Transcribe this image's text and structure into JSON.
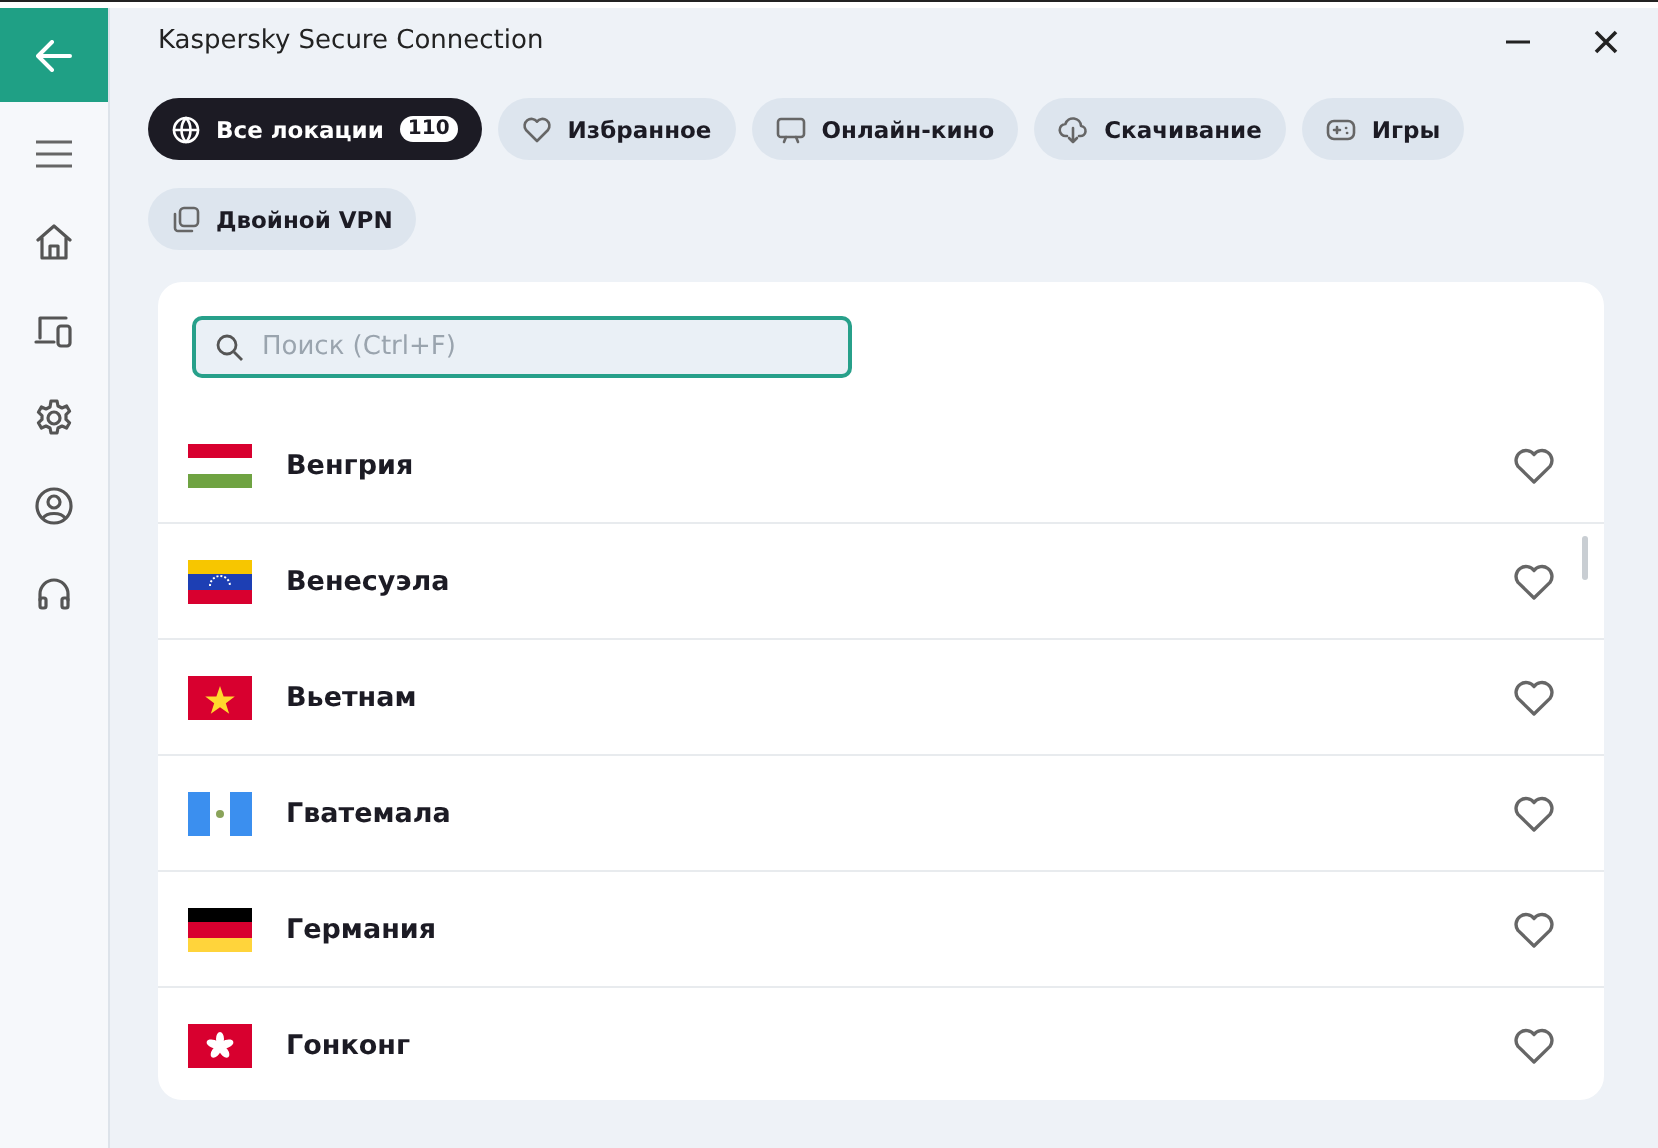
{
  "window": {
    "title": "Kaspersky Secure Connection"
  },
  "sidebar": {
    "items": [
      {
        "kind": "home",
        "selected": false
      },
      {
        "kind": "devices",
        "selected": false
      },
      {
        "kind": "settings",
        "selected": false
      },
      {
        "kind": "account",
        "selected": false
      },
      {
        "kind": "support",
        "selected": false
      }
    ]
  },
  "filters": [
    {
      "label": "Все локации",
      "kind": "globe",
      "count": "110",
      "selected": true
    },
    {
      "label": "Избранное",
      "kind": "heart",
      "selected": false
    },
    {
      "label": "Онлайн-кино",
      "kind": "screen",
      "selected": false
    },
    {
      "label": "Скачивание",
      "kind": "download",
      "selected": false
    },
    {
      "label": "Игры",
      "kind": "gamepad",
      "selected": false
    },
    {
      "label": "Двойной VPN",
      "kind": "copy",
      "selected": false
    }
  ],
  "search": {
    "placeholder": "Поиск (Ctrl+F)"
  },
  "locations": [
    {
      "name": "Венгрия",
      "kind": "hu",
      "favorite": false
    },
    {
      "name": "Венесуэла",
      "kind": "ve",
      "favorite": false
    },
    {
      "name": "Вьетнам",
      "kind": "vn",
      "favorite": false
    },
    {
      "name": "Гватемала",
      "kind": "gt",
      "favorite": false
    },
    {
      "name": "Германия",
      "kind": "de",
      "favorite": false
    },
    {
      "name": "Гонконг",
      "kind": "hk",
      "favorite": false
    }
  ]
}
